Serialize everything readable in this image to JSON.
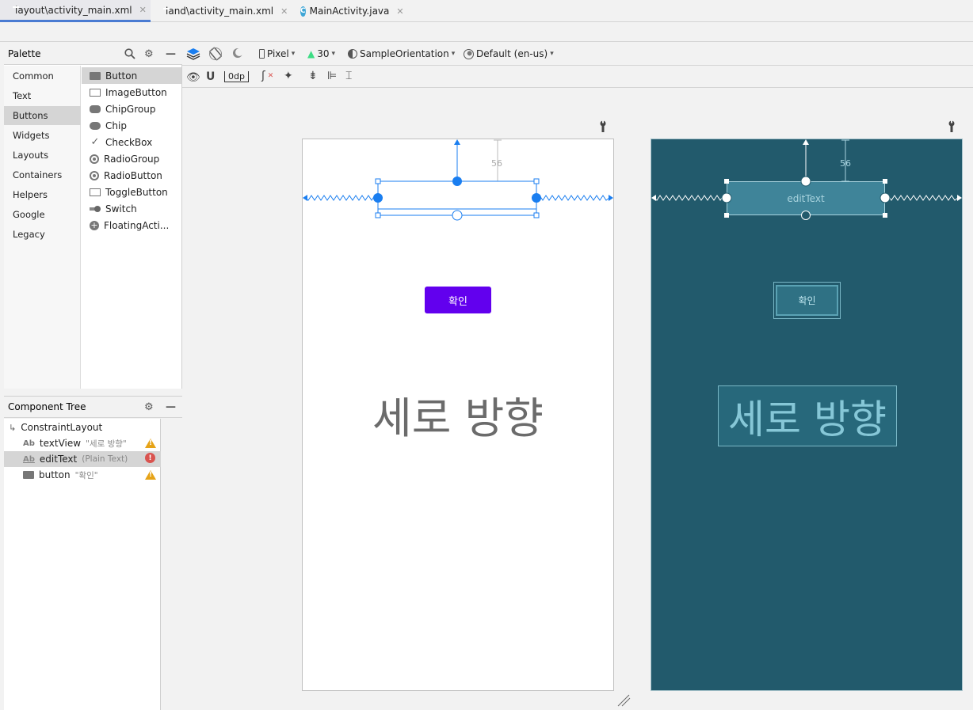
{
  "tabs": [
    {
      "label": "layout\\activity_main.xml"
    },
    {
      "label": "land\\activity_main.xml"
    },
    {
      "label": "MainActivity.java"
    }
  ],
  "palette": {
    "title": "Palette",
    "categories": [
      "Common",
      "Text",
      "Buttons",
      "Widgets",
      "Layouts",
      "Containers",
      "Helpers",
      "Google",
      "Legacy"
    ],
    "selected_category": "Buttons",
    "items": [
      "Button",
      "ImageButton",
      "ChipGroup",
      "Chip",
      "CheckBox",
      "RadioGroup",
      "RadioButton",
      "ToggleButton",
      "Switch",
      "FloatingActi..."
    ]
  },
  "component_tree": {
    "title": "Component Tree",
    "root": "ConstraintLayout",
    "children": [
      {
        "name": "textView",
        "text": "\"세로 방향\"",
        "status": "warning"
      },
      {
        "name": "editText",
        "text": "(Plain Text)",
        "status": "error"
      },
      {
        "name": "button",
        "text": "\"확인\"",
        "status": "warning"
      }
    ]
  },
  "toolbar": {
    "device": "Pixel",
    "api": "30",
    "orientation": "SampleOrientation",
    "locale": "Default (en-us)",
    "margin": "0dp"
  },
  "design": {
    "button_label": "확인",
    "textview_text": "세로 방향",
    "edittext_hint": "editText",
    "top_margin": "56"
  },
  "colors": {
    "accent": "#1a7ef0",
    "button": "#6200ee",
    "blueprint_bg": "#225a6c"
  }
}
